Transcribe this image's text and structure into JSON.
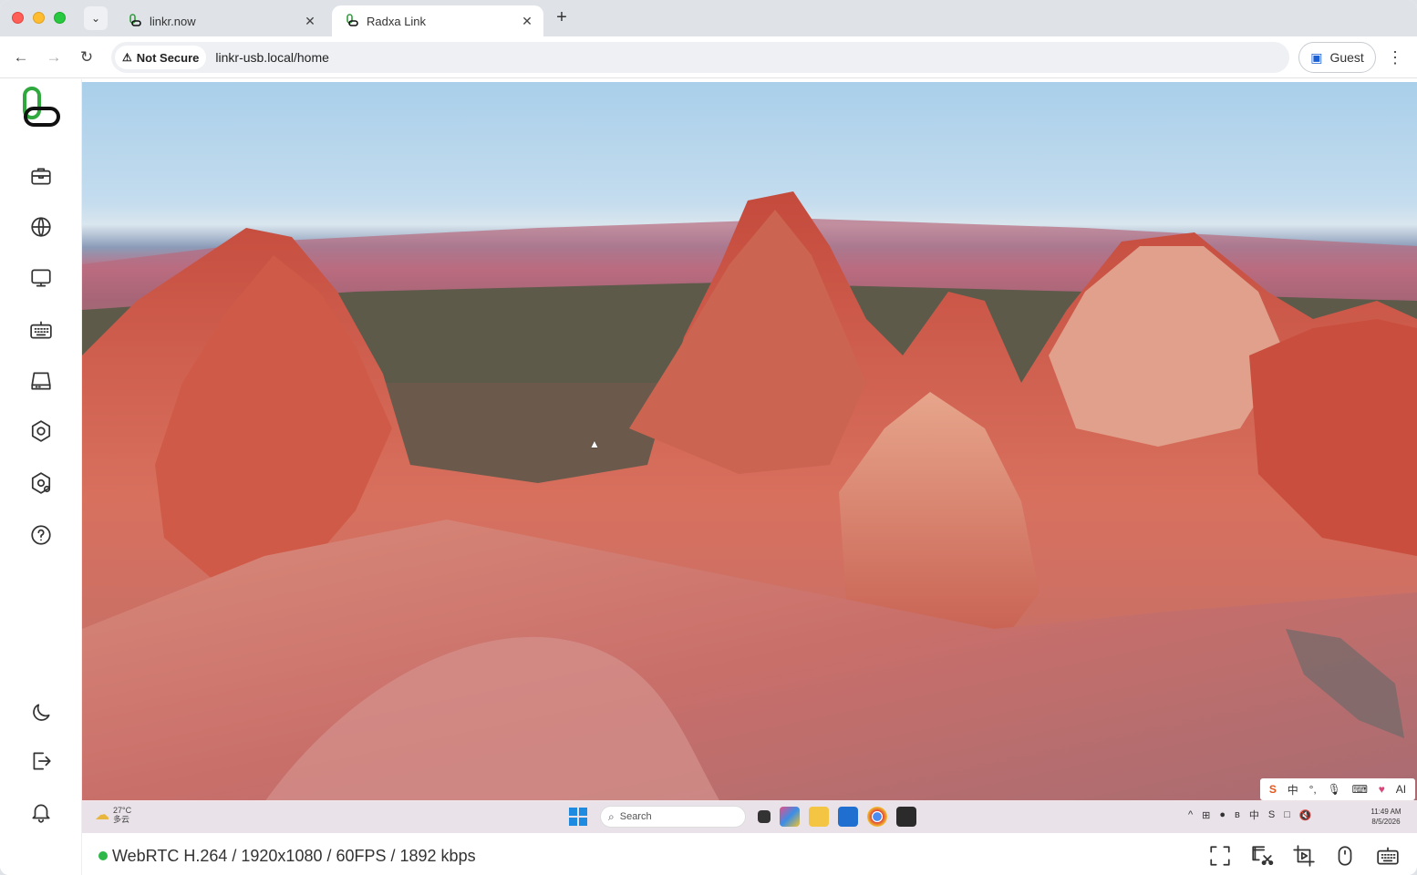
{
  "browser": {
    "tabs": [
      {
        "label": "linkr.now",
        "close": "✕"
      },
      {
        "label": "Radxa Link",
        "close": "✕"
      }
    ],
    "new_tab": "+",
    "tab_search": "⌄",
    "nav": {
      "back": "←",
      "forward": "→",
      "reload": "↻"
    },
    "security_label": "Not Secure",
    "security_icon": "⚠",
    "url": "linkr-usb.local/home",
    "profile_label": "Guest",
    "menu": "⋮"
  },
  "sidebar": {
    "logo": "linkr-logo",
    "items": [
      {
        "name": "toolbox-icon"
      },
      {
        "name": "globe-icon"
      },
      {
        "name": "monitor-icon"
      },
      {
        "name": "keyboard-icon"
      },
      {
        "name": "drive-icon"
      },
      {
        "name": "disc-icon"
      },
      {
        "name": "settings-icon"
      },
      {
        "name": "help-icon"
      }
    ],
    "bottom_items": [
      {
        "name": "moon-icon"
      },
      {
        "name": "logout-icon"
      },
      {
        "name": "bell-icon"
      }
    ]
  },
  "remote_desktop": {
    "ime": {
      "s": "S",
      "lang": "中",
      "punct": "°,",
      "mic": "🎙",
      "kbd": "⌨",
      "skin": "♥",
      "ai": "AI"
    },
    "taskbar": {
      "weather_temp": "27°C",
      "weather_desc": "多云",
      "search_placeholder": "Search",
      "clock_time": "11:49 AM",
      "clock_date": "8/5/2026",
      "tray": [
        "^",
        "⊞",
        "●",
        "ʙ",
        "中",
        "S",
        "□",
        "🔇"
      ]
    }
  },
  "status": {
    "stream_info": "WebRTC H.264 / 1920x1080 / 60FPS / 1892 kbps",
    "indicator_color": "#2eb84a"
  },
  "status_actions": [
    {
      "name": "fullscreen-icon"
    },
    {
      "name": "screenshot-icon"
    },
    {
      "name": "record-icon"
    },
    {
      "name": "mouse-icon"
    },
    {
      "name": "virtual-keyboard-icon"
    }
  ]
}
